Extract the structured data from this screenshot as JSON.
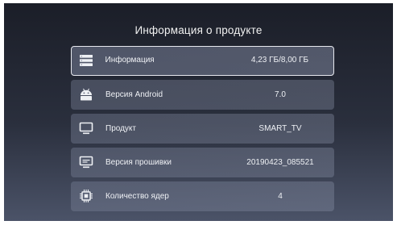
{
  "title": "Информация о продукте",
  "rows": [
    {
      "label": "Информация",
      "value": "4,23 ГБ/8,00 ГБ",
      "icon": "storage-icon"
    },
    {
      "label": "Версия Android",
      "value": "7.0",
      "icon": "android-icon"
    },
    {
      "label": "Продукт",
      "value": "SMART_TV",
      "icon": "monitor-icon"
    },
    {
      "label": "Версия прошивки",
      "value": "20190423_085521",
      "icon": "firmware-icon"
    },
    {
      "label": "Количество ядер",
      "value": "4",
      "icon": "cpu-chip-icon"
    }
  ],
  "selected_index": 0,
  "colors": {
    "text": "#eef0f4",
    "selection_border": "#e6e8ee",
    "background_top": "#1b1e28",
    "background_bottom": "#4b5368"
  }
}
